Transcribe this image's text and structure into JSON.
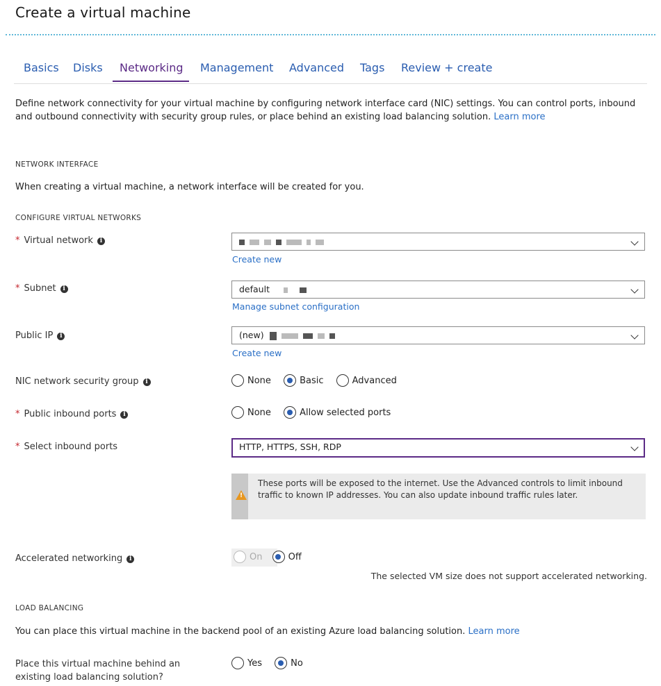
{
  "window": {
    "title": "Create a virtual machine"
  },
  "tabs": [
    {
      "label": "Basics"
    },
    {
      "label": "Disks"
    },
    {
      "label": "Networking"
    },
    {
      "label": "Management"
    },
    {
      "label": "Advanced"
    },
    {
      "label": "Tags"
    },
    {
      "label": "Review + create"
    }
  ],
  "active_tab": "Networking",
  "intro": {
    "text": "Define network connectivity for your virtual machine by configuring network interface card (NIC) settings. You can control ports, inbound and outbound connectivity with security group rules, or place behind an existing load balancing solution.",
    "link": "Learn more"
  },
  "network_interface": {
    "heading": "NETWORK INTERFACE",
    "text": "When creating a virtual machine, a network interface will be created for you."
  },
  "configure_vnets": {
    "heading": "CONFIGURE VIRTUAL NETWORKS"
  },
  "fields": {
    "virtual_network": {
      "label": "Virtual network",
      "link": "Create new"
    },
    "subnet": {
      "label": "Subnet",
      "value": "default",
      "link": "Manage subnet configuration"
    },
    "public_ip": {
      "label": "Public IP",
      "value": "(new)",
      "link": "Create new"
    },
    "nic_nsg": {
      "label": "NIC network security group",
      "options": [
        "None",
        "Basic",
        "Advanced"
      ],
      "selected": "Basic"
    },
    "public_inbound": {
      "label": "Public inbound ports",
      "options": [
        "None",
        "Allow selected ports"
      ],
      "selected": "Allow selected ports"
    },
    "select_inbound": {
      "label": "Select inbound ports",
      "value": "HTTP, HTTPS, SSH, RDP"
    },
    "accelerated": {
      "label": "Accelerated networking",
      "options": [
        "On",
        "Off"
      ],
      "selected": "Off",
      "note": "The selected VM size does not support accelerated networking."
    }
  },
  "warning": {
    "icon": "warning-icon",
    "color": "#e8971f",
    "text": "These ports will be exposed to the internet. Use the Advanced controls to limit inbound traffic to known IP addresses. You can also update inbound traffic rules later."
  },
  "load_balancing": {
    "heading": "LOAD BALANCING",
    "text": "You can place this virtual machine in the backend pool of an existing Azure load balancing solution.",
    "link": "Learn more",
    "question_line1": "Place this virtual machine behind an",
    "question_line2": "existing load balancing solution?",
    "options": [
      "Yes",
      "No"
    ],
    "selected": "No"
  },
  "colors": {
    "accent": "#5b2a86",
    "link": "#2a6fc6",
    "required": "#c4262e",
    "radio": "#2a5db0"
  }
}
